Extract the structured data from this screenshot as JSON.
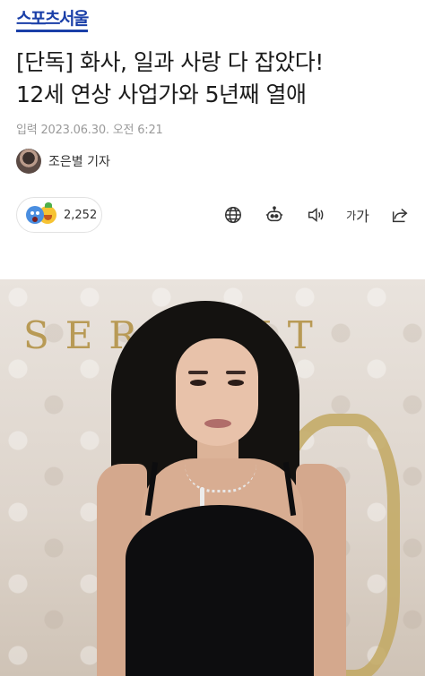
{
  "header": {
    "logo_text": "스포츠서울",
    "logo_color": "#1a3fa8"
  },
  "article": {
    "title_line1": "[단독] 화사, 일과 사랑 다 잡았다!",
    "title_line2": "12세 연상 사업가와 5년째 열애",
    "dateline": "입력 2023.06.30. 오전 6:21",
    "author": "조은별 기자"
  },
  "reactions": {
    "icons": [
      "surprised-emoji-icon",
      "happy-emoji-icon"
    ],
    "count": "2,252"
  },
  "toolbar": {
    "icons": [
      "globe-icon",
      "robot-icon",
      "speaker-icon",
      "font-size-icon",
      "share-icon"
    ],
    "font_small": "가",
    "font_large": "가"
  },
  "photo": {
    "backdrop_text": "SERPENT",
    "brand_color": "#b89a55"
  }
}
